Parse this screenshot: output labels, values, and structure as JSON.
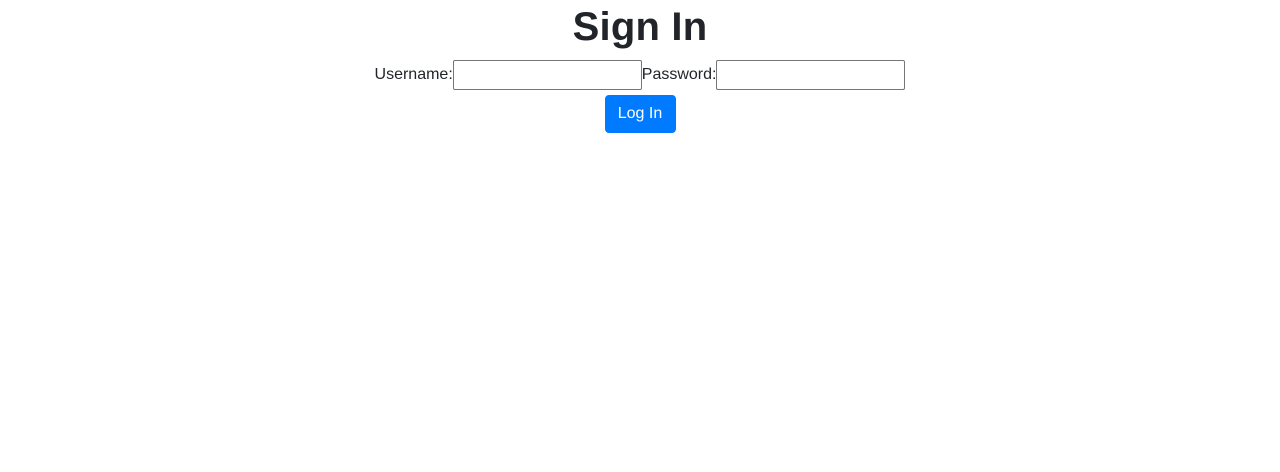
{
  "page": {
    "title": "Sign In"
  },
  "form": {
    "username_label": "Username:",
    "username_value": "",
    "password_label": "Password:",
    "password_value": "",
    "submit_label": "Log In"
  },
  "colors": {
    "primary_button": "#007bff",
    "text": "#212529",
    "background": "#ffffff"
  }
}
